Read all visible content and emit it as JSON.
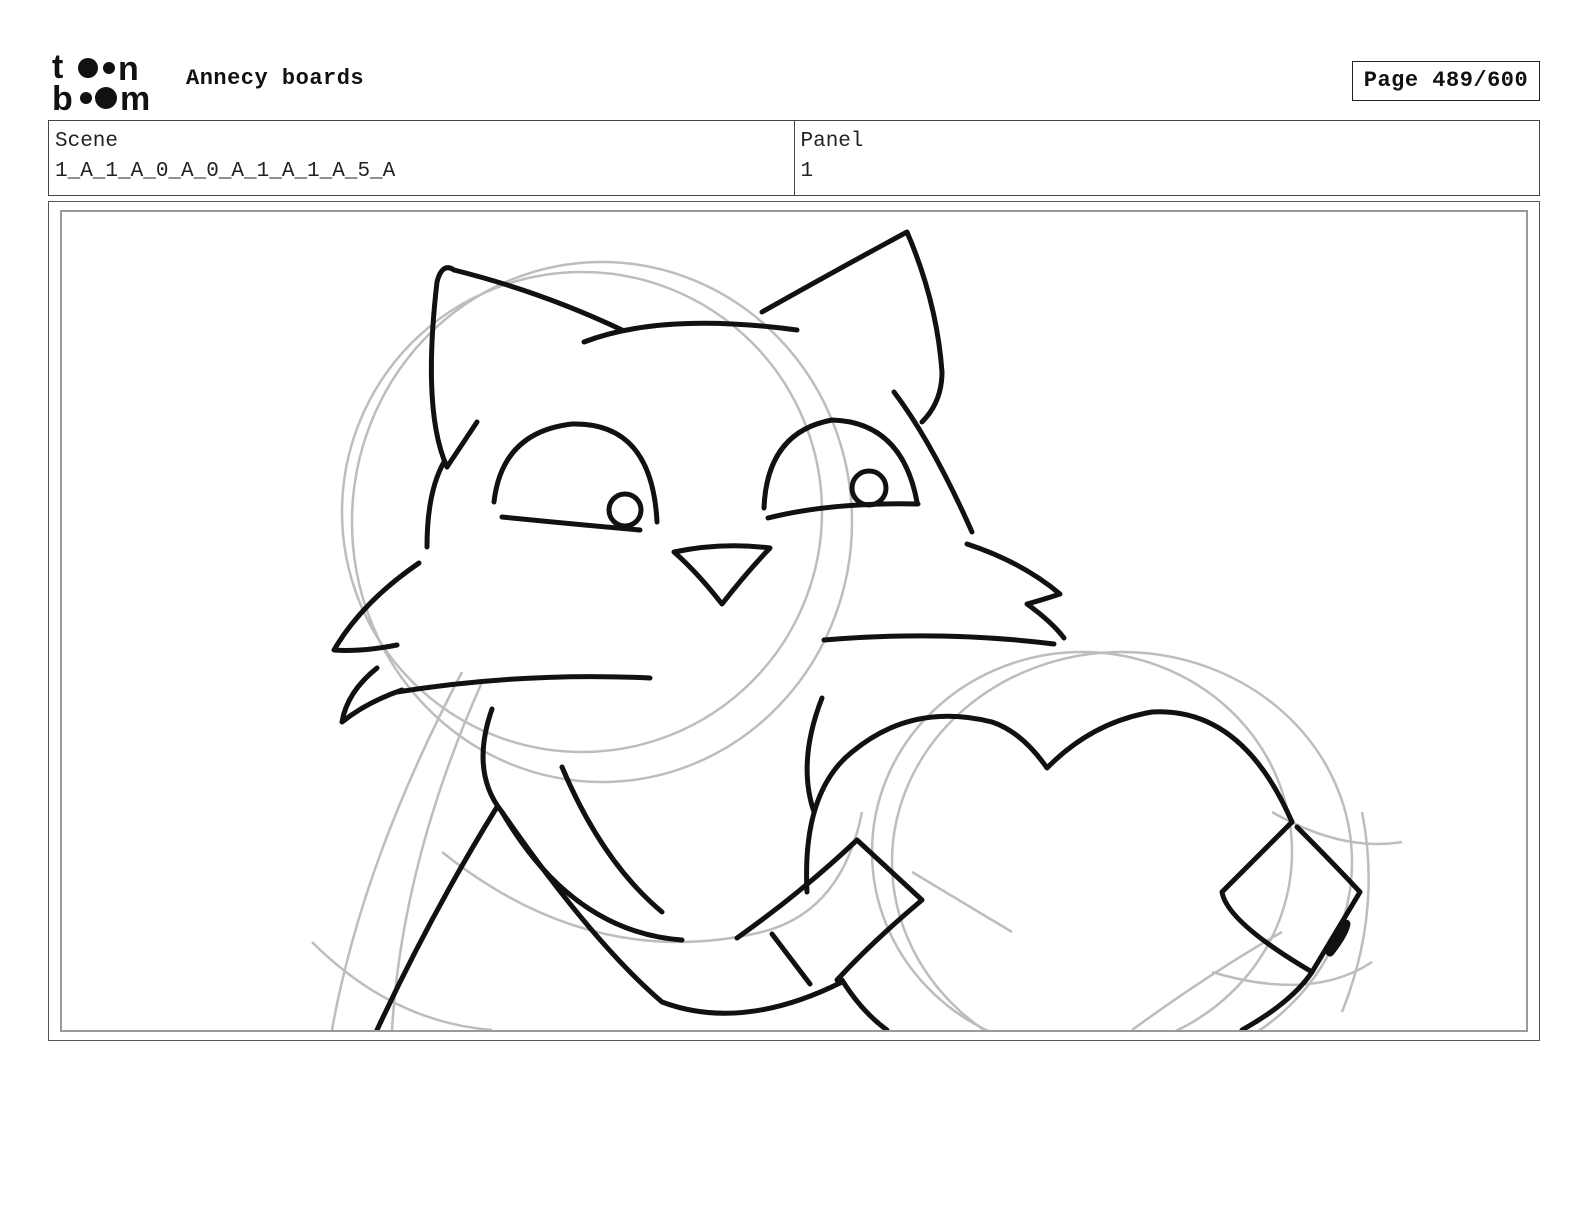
{
  "header": {
    "logo_text": "toonboom",
    "app_title": "Annecy boards",
    "page_indicator": "Page 489/600"
  },
  "scene_info": {
    "scene_label": "Scene",
    "scene_value": "1_A_1_A_0_A_0_A_1_A_1_A_5_A",
    "panel_label": "Panel",
    "panel_value": "1"
  },
  "drawing": {
    "subject": "cat-character-holding-heart",
    "line_color": "#111111",
    "sketch_color": "#bdbdbd"
  }
}
